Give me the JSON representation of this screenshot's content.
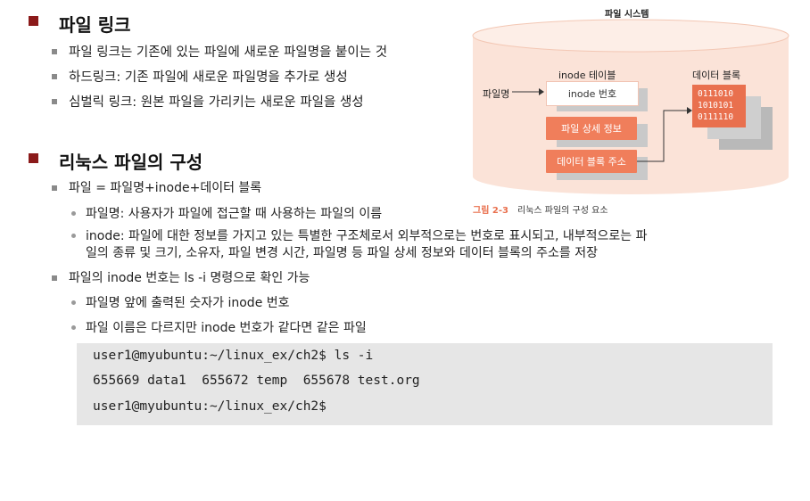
{
  "section1": {
    "title": "파일 링크",
    "bullets": [
      "파일 링크는 기존에 있는 파일에 새로운 파일명을 붙이는 것",
      "하드링크: 기존 파일에 새로운 파일명을 추가로 생성",
      "심벌릭 링크:  원본 파일을 가리키는 새로운 파일을 생성"
    ]
  },
  "section2": {
    "title": "리눅스 파일의 구성",
    "bullet1": "파일 = 파일명+inode+데이터 블록",
    "sub1": [
      "파일명: 사용자가 파일에 접근할 때 사용하는 파일의 이름",
      "inode: 파일에 대한 정보를 가지고 있는 특별한 구조체로서 외부적으로는 번호로 표시되고, 내부적으로는 파",
      "일의 종류 및 크기, 소유자, 파일 변경 시간, 파일명 등 파일 상세 정보와 데이터 블록의 주소를 저장"
    ],
    "bullet2": "파일의 inode 번호는 ls -i 명령으로 확인 가능",
    "sub2": [
      "파일명 앞에 출력된 숫자가 inode 번호",
      "파일 이름은 다르지만 inode 번호가 같다면 같은 파일"
    ]
  },
  "code": {
    "lines": [
      "user1@myubuntu:~/linux_ex/ch2$ ls -i",
      "655669 data1  655672 temp  655678 test.org",
      "user1@myubuntu:~/linux_ex/ch2$"
    ]
  },
  "figure": {
    "title": "파일 시스템",
    "inode_table_label": "inode 테이블",
    "data_block_label": "데이터 블록",
    "filename_label": "파일명",
    "inode_number": "inode 번호",
    "file_detail": "파일 상세 정보",
    "block_address": "데이터 블록 주소",
    "data_bits": [
      "0111010",
      "1010101",
      "0111110"
    ],
    "caption_number": "그림 2-3",
    "caption_text": "리눅스 파일의 구성 요소",
    "colors": {
      "accent": "#f07e5b",
      "cylinder": "#fbe3d8",
      "heading_square": "#8b1a1a"
    }
  }
}
